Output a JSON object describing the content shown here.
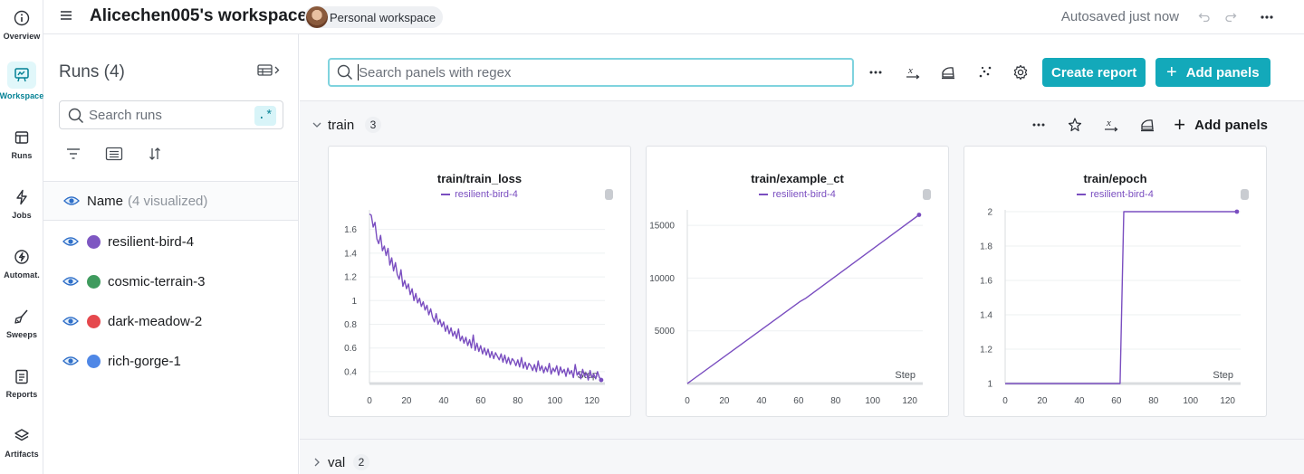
{
  "rail": [
    {
      "label": "Overview",
      "icon": "info-icon"
    },
    {
      "label": "Workspace",
      "icon": "workspace-icon",
      "active": true
    },
    {
      "label": "Runs",
      "icon": "runs-icon"
    },
    {
      "label": "Jobs",
      "icon": "jobs-icon"
    },
    {
      "label": "Automat.",
      "icon": "automations-icon"
    },
    {
      "label": "Sweeps",
      "icon": "sweeps-icon"
    },
    {
      "label": "Reports",
      "icon": "reports-icon"
    },
    {
      "label": "Artifacts",
      "icon": "artifacts-icon"
    }
  ],
  "header": {
    "title": "Alicechen005's workspace",
    "workspace_pill": "Personal workspace",
    "autosaved": "Autosaved just now"
  },
  "runs_panel": {
    "title": "Runs (4)",
    "search_placeholder": "Search runs",
    "regex_label": ".*",
    "column_name": "Name",
    "column_visualized": "(4 visualized)",
    "runs": [
      {
        "name": "resilient-bird-4",
        "color": "#7e57c2"
      },
      {
        "name": "cosmic-terrain-3",
        "color": "#3f9b5e"
      },
      {
        "name": "dark-meadow-2",
        "color": "#e5484d"
      },
      {
        "name": "rich-gorge-1",
        "color": "#4f87e6"
      }
    ]
  },
  "toolbar": {
    "search_placeholder": "Search panels with regex",
    "create_report": "Create report",
    "add_panels": "Add panels"
  },
  "sections": [
    {
      "name": "train",
      "count": "3",
      "add_panels": "Add panels",
      "expanded": true
    },
    {
      "name": "val",
      "count": "2",
      "expanded": false
    }
  ],
  "accent_color": "#13a9ba",
  "chart_data": [
    {
      "type": "line",
      "title": "train/train_loss",
      "series": [
        {
          "name": "resilient-bird-4",
          "color": "#7a4ec0"
        }
      ],
      "xlabel": "Step",
      "x_ticks": [
        "0",
        "20",
        "40",
        "60",
        "80",
        "100",
        "120"
      ],
      "y_ticks": [
        "0.4",
        "0.6",
        "0.8",
        "1",
        "1.2",
        "1.4",
        "1.6"
      ],
      "xlim": [
        0,
        127
      ],
      "ylim": [
        0.3,
        1.75
      ],
      "x": [
        0,
        1,
        2,
        3,
        4,
        5,
        6,
        7,
        8,
        9,
        10,
        11,
        12,
        13,
        14,
        15,
        16,
        17,
        18,
        19,
        20,
        21,
        22,
        23,
        24,
        25,
        26,
        27,
        28,
        29,
        30,
        31,
        32,
        33,
        34,
        35,
        36,
        37,
        38,
        39,
        40,
        41,
        42,
        43,
        44,
        45,
        46,
        47,
        48,
        49,
        50,
        51,
        52,
        53,
        54,
        55,
        56,
        57,
        58,
        59,
        60,
        61,
        62,
        63,
        64,
        65,
        66,
        67,
        68,
        69,
        70,
        71,
        72,
        73,
        74,
        75,
        76,
        77,
        78,
        79,
        80,
        81,
        82,
        83,
        84,
        85,
        86,
        87,
        88,
        89,
        90,
        91,
        92,
        93,
        94,
        95,
        96,
        97,
        98,
        99,
        100,
        101,
        102,
        103,
        104,
        105,
        106,
        107,
        108,
        109,
        110,
        111,
        112,
        113,
        114,
        115,
        116,
        117,
        118,
        119,
        120,
        121,
        122,
        123,
        124,
        125
      ],
      "y": [
        1.73,
        1.72,
        1.62,
        1.66,
        1.52,
        1.48,
        1.55,
        1.42,
        1.46,
        1.38,
        1.44,
        1.3,
        1.36,
        1.25,
        1.32,
        1.22,
        1.18,
        1.26,
        1.12,
        1.17,
        1.1,
        1.14,
        1.05,
        1.1,
        1.0,
        1.06,
        0.98,
        1.02,
        0.95,
        0.99,
        0.92,
        0.96,
        0.88,
        0.93,
        0.86,
        0.82,
        0.89,
        0.8,
        0.84,
        0.78,
        0.82,
        0.74,
        0.79,
        0.72,
        0.77,
        0.7,
        0.74,
        0.68,
        0.76,
        0.66,
        0.7,
        0.64,
        0.69,
        0.62,
        0.67,
        0.6,
        0.71,
        0.58,
        0.64,
        0.57,
        0.62,
        0.55,
        0.6,
        0.54,
        0.59,
        0.52,
        0.57,
        0.51,
        0.56,
        0.53,
        0.5,
        0.55,
        0.48,
        0.54,
        0.47,
        0.52,
        0.46,
        0.51,
        0.49,
        0.45,
        0.5,
        0.44,
        0.52,
        0.43,
        0.48,
        0.42,
        0.47,
        0.45,
        0.41,
        0.46,
        0.4,
        0.49,
        0.41,
        0.45,
        0.39,
        0.44,
        0.4,
        0.47,
        0.38,
        0.43,
        0.4,
        0.45,
        0.37,
        0.44,
        0.39,
        0.42,
        0.36,
        0.43,
        0.38,
        0.41,
        0.35,
        0.46,
        0.37,
        0.4,
        0.34,
        0.42,
        0.36,
        0.39,
        0.33,
        0.41,
        0.35,
        0.38,
        0.34,
        0.4,
        0.35,
        0.33
      ]
    },
    {
      "type": "line",
      "title": "train/example_ct",
      "series": [
        {
          "name": "resilient-bird-4",
          "color": "#7a4ec0"
        }
      ],
      "xlabel": "Step",
      "x_ticks": [
        "0",
        "20",
        "40",
        "60",
        "80",
        "100",
        "120"
      ],
      "y_ticks": [
        "5000",
        "10000",
        "15000"
      ],
      "xlim": [
        0,
        127
      ],
      "ylim": [
        0,
        16300
      ],
      "x": [
        0,
        61,
        64,
        125
      ],
      "y": [
        0,
        7800,
        8100,
        16000
      ]
    },
    {
      "type": "line",
      "title": "train/epoch",
      "series": [
        {
          "name": "resilient-bird-4",
          "color": "#7a4ec0"
        }
      ],
      "xlabel": "Step",
      "x_ticks": [
        "0",
        "20",
        "40",
        "60",
        "80",
        "100",
        "120"
      ],
      "y_ticks": [
        "1",
        "1.2",
        "1.4",
        "1.6",
        "1.8",
        "2"
      ],
      "xlim": [
        0,
        127
      ],
      "ylim": [
        1,
        2
      ],
      "x": [
        0,
        62,
        64,
        125
      ],
      "y": [
        1,
        1,
        2,
        2
      ]
    }
  ]
}
